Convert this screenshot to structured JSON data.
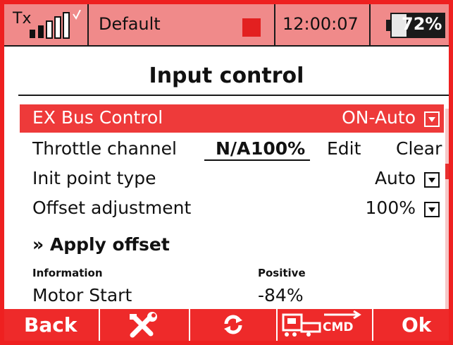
{
  "status": {
    "tx_label": "Tx",
    "model_name": "Default",
    "time": "12:00:07",
    "battery_text": "72%",
    "battery_level": 0.72
  },
  "title": "Input control",
  "rows": {
    "exbus": {
      "label": "EX Bus Control",
      "value": "ON-Auto"
    },
    "throttle": {
      "label": "Throttle channel",
      "channel": "N/A",
      "percent": "100%",
      "edit": "Edit",
      "clear": "Clear"
    },
    "init": {
      "label": "Init point type",
      "value": "Auto"
    },
    "offset": {
      "label": "Offset adjustment",
      "value": "100%"
    }
  },
  "apply_offset": "» Apply offset",
  "info": {
    "header": "Information",
    "positive_header": "Positive",
    "motor_label": "Motor Start",
    "motor_value": "-84%"
  },
  "footer": {
    "back": "Back",
    "cmd_text": "CMD",
    "ok": "Ok"
  },
  "icons": {
    "signal": "signal-bars-icon",
    "record": "record-square-icon",
    "battery": "battery-icon",
    "dropdown": "dropdown-arrow-icon",
    "tools": "tools-icon",
    "sync": "sync-icon",
    "cmd": "cmd-device-icon"
  },
  "colors": {
    "accent": "#ee2a2a",
    "status_bg": "#f08a8a",
    "selected_row": "#ee3a3a"
  }
}
